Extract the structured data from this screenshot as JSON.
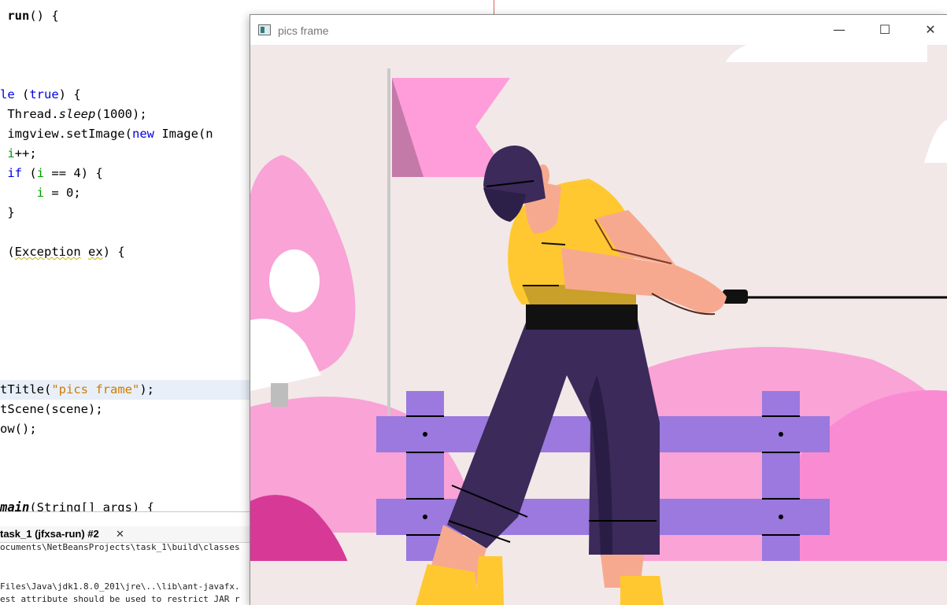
{
  "editor": {
    "lines": [
      {
        "segments": [
          {
            "t": " "
          },
          {
            "t": "run",
            "c": "bold"
          },
          {
            "t": "() {"
          }
        ]
      },
      {
        "segments": [
          {
            "t": "le",
            "c": "kw"
          },
          {
            "t": " ("
          },
          {
            "t": "true",
            "c": "kw"
          },
          {
            "t": ") {"
          }
        ]
      },
      {
        "segments": [
          {
            "t": " Thread."
          },
          {
            "t": "sleep",
            "c": "it"
          },
          {
            "t": "(1000);"
          }
        ]
      },
      {
        "segments": [
          {
            "t": " imgview.setImage("
          },
          {
            "t": "new",
            "c": "kw"
          },
          {
            "t": " Image(n"
          }
        ]
      },
      {
        "segments": [
          {
            "t": " "
          },
          {
            "t": "i",
            "c": "var"
          },
          {
            "t": "++;"
          }
        ]
      },
      {
        "segments": [
          {
            "t": " "
          },
          {
            "t": "if",
            "c": "kw"
          },
          {
            "t": " ("
          },
          {
            "t": "i",
            "c": "var"
          },
          {
            "t": " == 4) {"
          }
        ]
      },
      {
        "segments": [
          {
            "t": "     "
          },
          {
            "t": "i",
            "c": "var"
          },
          {
            "t": " = 0;"
          }
        ]
      },
      {
        "segments": [
          {
            "t": " }"
          }
        ]
      },
      {
        "segments": [
          {
            "t": " ("
          },
          {
            "t": "Exception",
            "c": "warn"
          },
          {
            "t": " "
          },
          {
            "t": "ex",
            "c": "warn"
          },
          {
            "t": ") {"
          }
        ]
      },
      {
        "segments": [
          {
            "t": "tTitle("
          },
          {
            "t": "\"pics frame\"",
            "c": "str"
          },
          {
            "t": ");"
          }
        ]
      },
      {
        "segments": [
          {
            "t": "tScene(scene);"
          }
        ]
      },
      {
        "segments": [
          {
            "t": "ow();"
          }
        ]
      },
      {
        "segments": [
          {
            "t": "main",
            "c": "bold it"
          },
          {
            "t": "(String[] args) {"
          }
        ]
      }
    ]
  },
  "output": {
    "tab_label": "task_1 (jfxsa-run) #2",
    "tab_close": "✕",
    "lines": [
      "ocuments\\NetBeansProjects\\task_1\\build\\classes",
      "Files\\Java\\jdk1.8.0_201\\jre\\..\\lib\\ant-javafx.",
      "est attribute should be used to restrict JAR r"
    ]
  },
  "window": {
    "title": "pics frame",
    "minimize_glyph": "—",
    "maximize_glyph": "☐",
    "close_glyph": "✕"
  },
  "colors": {
    "scene_bg": "#f2e8e7",
    "pink_light": "#f9a3d6",
    "pink_hot": "#d63a96",
    "purple_fence": "#9b79de",
    "shirt_yellow": "#ffc830",
    "pants_navy": "#3b2a5a",
    "skin": "#f7a98f"
  }
}
